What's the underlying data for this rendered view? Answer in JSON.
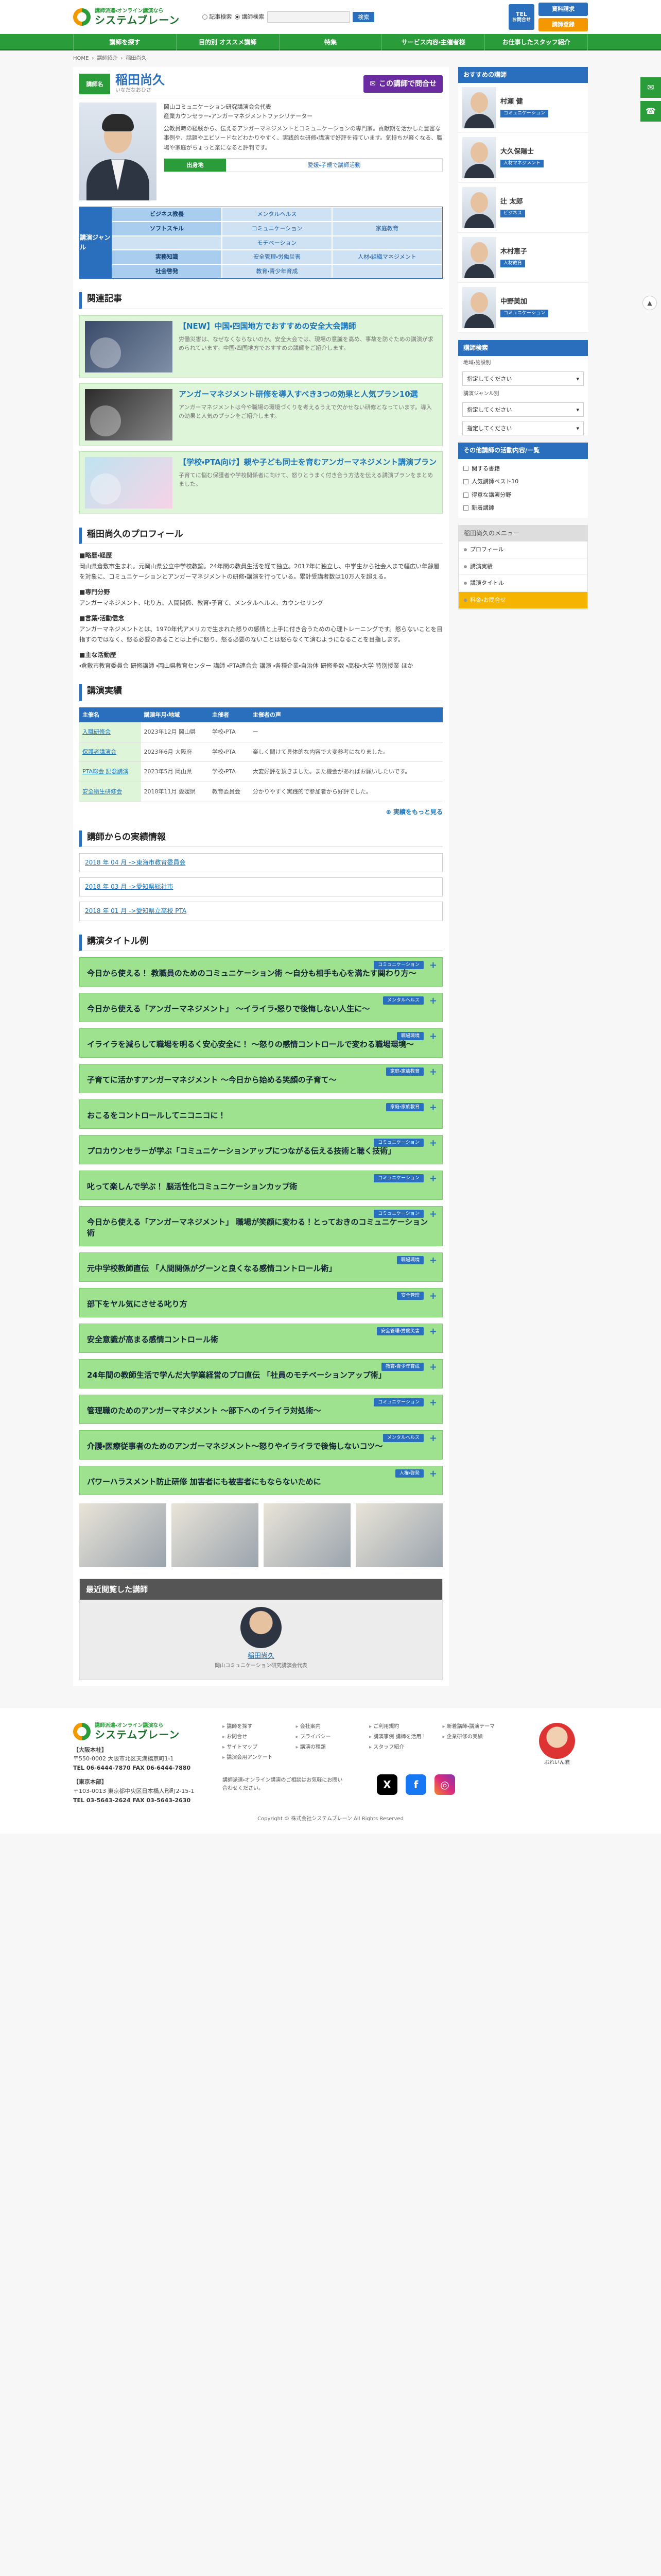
{
  "header": {
    "logo_sub": "講師派遣・オンライン講演なら",
    "logo_main": "システムブレーン",
    "radio_lecturer": "記事検索",
    "radio_keyword": "講師検索",
    "search_placeholder": "",
    "search_button": "検索",
    "doc_button": "資料請求",
    "lecture_button": "講師登録",
    "tel_label": "TEL",
    "tel_sub": "お問合せ"
  },
  "nav": [
    "講師を探す",
    "目的別 オススメ講師",
    "特集",
    "サービス内容・主催者様",
    "お仕事したスタッフ紹介"
  ],
  "breadcrumb": [
    "HOME",
    "講師紹介",
    "稲田尚久"
  ],
  "profile": {
    "badge": "講師名",
    "name": "稲田尚久",
    "kana": "いなだなおひさ",
    "contact": "この講師で問合せ",
    "titles": [
      "岡山コミュニケーション研究講演会会代表",
      "産業カウンセラー・アンガーマネジメントファシリテーター"
    ],
    "desc": "公教員時の経験から、伝えるアンガーマネジメントとコミュニケーションの専門家。貢献期を活かした豊富な事例や、話題やエピソードなどわかりやすく、実践的な研修・講演で好評を得ています。気持ちが軽くなる、職場や家庭がちょっと楽になると評判です。",
    "area_label": "出身地",
    "area_value": "愛媛・子規で講師活動",
    "genre_label": "講演ジャンル",
    "genres": [
      {
        "text": "ビジネス教養",
        "h": true
      },
      {
        "text": "メンタルヘルス",
        "h": false
      },
      {
        "text": "",
        "h": false
      },
      {
        "text": "ソフトスキル",
        "h": true
      },
      {
        "text": "コミュニケーション",
        "h": false
      },
      {
        "text": "家庭教育",
        "h": false
      },
      {
        "text": "",
        "h": false
      },
      {
        "text": "モチベーション",
        "h": false
      },
      {
        "text": "",
        "h": false
      },
      {
        "text": "実務知識",
        "h": true
      },
      {
        "text": "安全管理・労働災害",
        "h": false
      },
      {
        "text": "人材・組織マネジメント",
        "h": false
      },
      {
        "text": "社会啓発",
        "h": true
      },
      {
        "text": "教育・青少年育成",
        "h": false
      },
      {
        "text": "",
        "h": false
      }
    ]
  },
  "related": {
    "title": "関連記事",
    "items": [
      {
        "title": "【NEW】中国・四国地方でおすすめの安全大会講師",
        "desc": "労働災害は、なぜなくならないのか。安全大会では、現場の意識を高め、事故を防ぐための講演が求められています。中国・四国地方でおすすめの講師をご紹介します。"
      },
      {
        "title": "アンガーマネジメント研修を導入すべき3つの効果と人気プラン10選",
        "desc": "アンガーマネジメントは今や職場の環境づくりを考えるうえで欠かせない研修となっています。導入の効果と人気のプランをご紹介します。"
      },
      {
        "title": "【学校・PTA向け】親や子ども同士を育むアンガーマネジメント講演プラン",
        "desc": "子育てに悩む保護者や学校関係者に向けて、怒りとうまく付き合う方法を伝える講演プランをまとめました。"
      }
    ]
  },
  "bio": {
    "title": "稲田尚久のプロフィール",
    "sections": [
      {
        "h": "■略歴・経歴",
        "t": "岡山県倉敷市生まれ。元岡山県公立中学校教諭。24年間の教員生活を経て独立。2017年に独立し、中学生から社会人まで幅広い年齢層を対象に、コミュニケーションとアンガーマネジメントの研修・講演を行っている。累計受講者数は10万人を超える。"
      },
      {
        "h": "■専門分野",
        "t": "アンガーマネジメント、叱り方、人間関係、教育・子育て、メンタルヘルス、カウンセリング"
      },
      {
        "h": "■言葉・活動信念",
        "t": "アンガーマネジメントとは、1970年代アメリカで生まれた怒りの感情と上手に付き合うための心理トレーニングです。怒らないことを目指すのではなく、怒る必要のあることは上手に怒り、怒る必要のないことは怒らなくて済むようになることを目指します。"
      },
      {
        "h": "■主な活動歴",
        "t": "・倉敷市教育委員会 研修講師 ・岡山県教育センター 講師 ・PTA連合会 講演 ・各種企業・自治体 研修多数 ・高校・大学 特別授業 ほか"
      }
    ]
  },
  "perf": {
    "title": "講演実績",
    "headers": [
      "主催名",
      "講演年月・地域",
      "主催者",
      "主催者の声"
    ],
    "rows": [
      [
        "入職研修会",
        "2023年12月 岡山県",
        "学校・PTA",
        "ー"
      ],
      [
        "保護者講演会",
        "2023年6月 大阪府",
        "学校・PTA",
        "楽しく聞けて具体的な内容で大変参考になりました。"
      ],
      [
        "PTA総会 記念講演",
        "2023年5月 岡山県",
        "学校・PTA",
        "大変好評を頂きました。また機会があればお願いしたいです。"
      ],
      [
        "安全衛生研修会",
        "2018年11月 愛媛県",
        "教育委員会",
        "分かりやすく実践的で参加者から好評でした。"
      ]
    ],
    "more": "実績をもっと見る"
  },
  "records": {
    "title": "講師からの実績情報",
    "items": [
      "2018 年 04 月 ->東海市教育委員会",
      "2018 年 03 月 ->愛知県総社市",
      "2018 年 01 月 ->愛知県立高校 PTA"
    ]
  },
  "lectures": {
    "title": "講演タイトル例",
    "items": [
      {
        "tag": "コミュニケーション",
        "title": "今日から使える！ 教職員のためのコミュニケーション術 〜自分も相手も心を満たす関わり方〜"
      },
      {
        "tag": "メンタルヘルス",
        "title": "今日から使える「アンガーマネジメント」 〜イライラ・怒りで後悔しない人生に〜"
      },
      {
        "tag": "職場環境",
        "title": "イライラを減らして職場を明るく安心安全に！ 〜怒りの感情コントロールで変わる職場環境〜"
      },
      {
        "tag": "家庭・家族教育",
        "title": "子育てに活かすアンガーマネジメント 〜今日から始める笑顔の子育て〜"
      },
      {
        "tag": "家庭・家族教育",
        "title": "おこるをコントロールしてニコニコに！"
      },
      {
        "tag": "コミュニケーション",
        "title": "プロカウンセラーが学ぶ「コミュニケーションアップにつながる伝える技術と聴く技術」"
      },
      {
        "tag": "コミュニケーション",
        "title": "叱って楽しんで学ぶ！ 脳活性化コミュニケーションカップ術"
      },
      {
        "tag": "コミュニケーション",
        "title": "今日から使える「アンガーマネジメント」 職場が笑顔に変わる！とっておきのコミュニケーション術"
      },
      {
        "tag": "職場環境",
        "title": "元中学校教師直伝 「人間関係がグーンと良くなる感情コントロール術」"
      },
      {
        "tag": "安全管理",
        "title": "部下をヤル気にさせる叱り方"
      },
      {
        "tag": "安全管理・労働災害",
        "title": "安全意識が高まる感情コントロール術"
      },
      {
        "tag": "教育・青少年育成",
        "title": "24年間の教師生活で学んだ大学業経営のプロ直伝 「社員のモチベーションアップ術」"
      },
      {
        "tag": "コミュニケーション",
        "title": "管理職のためのアンガーマネジメント 〜部下へのイライラ対処術〜"
      },
      {
        "tag": "メンタルヘルス",
        "title": "介護・医療従事者のためのアンガーマネジメント〜怒りやイライラで後悔しないコツ〜"
      },
      {
        "tag": "人権・啓発",
        "title": "パワーハラスメント防止研修 加害者にも被害者にもならないために"
      }
    ]
  },
  "recent": {
    "title": "最近閲覧した講師",
    "name": "稲田尚久",
    "role": "岡山コミュニケーション研究講演会代表"
  },
  "sidebar": {
    "rec_title": "おすすめの講師",
    "rec": [
      {
        "name": "村瀬 健",
        "tag": "コミュニケーション"
      },
      {
        "name": "大久保陽士",
        "tag": "人材マネジメント"
      },
      {
        "name": "辻 太郎",
        "tag": "ビジネス"
      },
      {
        "name": "木村恵子",
        "tag": "人材教育"
      },
      {
        "name": "中野美加",
        "tag": "コミュニケーション"
      }
    ],
    "search_title": "講師検索",
    "sel_label1": "地域・施設別",
    "sel1": "指定してください",
    "sel_label2": "講演ジャンル別",
    "sel2": "指定してください",
    "sel3": "指定してください",
    "check_title": "その他講師の活動内容/一覧",
    "checks": [
      "関する書籍",
      "人気講師ベスト10",
      "得意な講演分野",
      "新着講師"
    ],
    "menu_title": "稲田尚久のメニュー",
    "menu": [
      "プロフィール",
      "講演実績",
      "講演タイトル",
      "料金・お問合せ"
    ]
  },
  "footer": {
    "logo_sub": "講師派遣・オンライン講演なら",
    "logo_main": "システムブレーン",
    "offices": [
      {
        "name": "【大阪本社】",
        "addr": "〒550-0002 大阪市北区天満橋京町1-1",
        "tel": "TEL 06-6444-7870 FAX 06-6444-7880"
      },
      {
        "name": "【東京本部】",
        "addr": "〒103-0013 東京都中央区日本橋人形町2-15-1",
        "tel": "TEL 03-5643-2624 FAX 03-5643-2630"
      }
    ],
    "links": [
      "講師を探す",
      "会社案内",
      "ご利用規約",
      "新着講師・講演テーマ",
      "お問合せ",
      "プライバシー",
      "講演事例 講師を活用！",
      "企業研修の実績",
      "サイトマップ",
      "講演の種類",
      "スタッフ紹介",
      "",
      "講演会用アンケート",
      "",
      "",
      ""
    ],
    "note": "講師派遣・オンライン講演のご相談はお気軽にお問い合わせください。",
    "mascot": "ぶれいん君",
    "copyright": "Copyright © 株式会社システムブレーン All Rights Reserved"
  }
}
